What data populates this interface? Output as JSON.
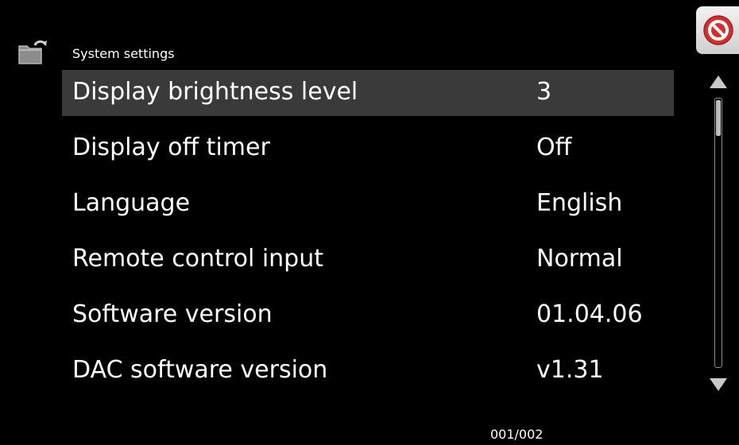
{
  "header": {
    "title": "System settings",
    "back_icon": "folder-back-icon",
    "close_icon": "no-entry-icon"
  },
  "settings": [
    {
      "label": "Display brightness level",
      "value": "3",
      "selected": true
    },
    {
      "label": "Display off timer",
      "value": "Off",
      "selected": false
    },
    {
      "label": "Language",
      "value": "English",
      "selected": false
    },
    {
      "label": "Remote control input",
      "value": "Normal",
      "selected": false
    },
    {
      "label": "Software version",
      "value": "01.04.06",
      "selected": false
    },
    {
      "label": "DAC software version",
      "value": "v1.31",
      "selected": false
    }
  ],
  "footer": {
    "page_indicator": "001/002"
  },
  "colors": {
    "background": "#000000",
    "selected_row": "#3a3a3a",
    "text": "#ffffff",
    "close_red": "#d32f2f"
  }
}
